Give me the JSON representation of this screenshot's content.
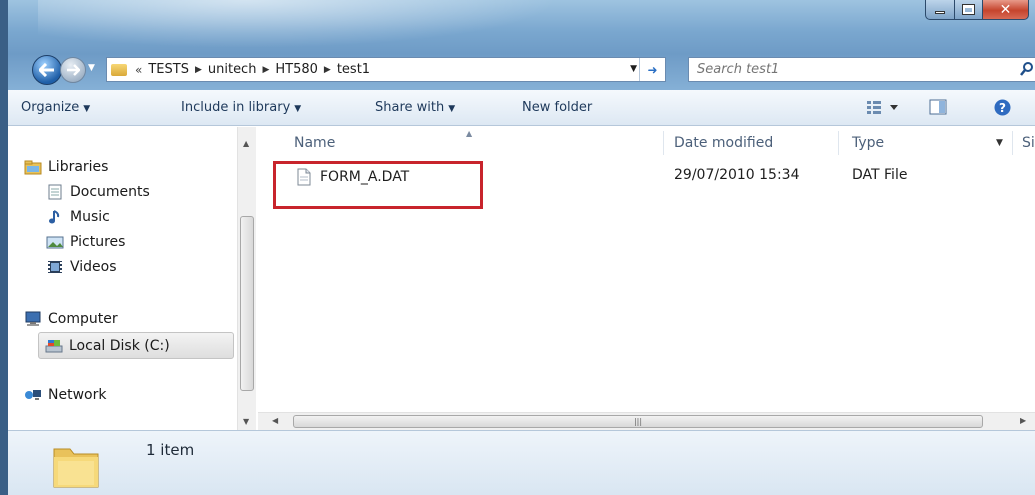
{
  "address": {
    "breadcrumb": [
      "TESTS",
      "unitech",
      "HT580",
      "test1"
    ],
    "overflow": "«"
  },
  "search": {
    "placeholder": "Search test1"
  },
  "toolbar": {
    "organize": "Organize",
    "include_in_library": "Include in library",
    "share_with": "Share with",
    "new_folder": "New folder"
  },
  "nav": {
    "libraries": "Libraries",
    "documents": "Documents",
    "music": "Music",
    "pictures": "Pictures",
    "videos": "Videos",
    "computer": "Computer",
    "local_disk": "Local Disk (C:)",
    "network": "Network"
  },
  "columns": {
    "name": "Name",
    "date_modified": "Date modified",
    "type": "Type",
    "size": "Siz"
  },
  "files": [
    {
      "name": "FORM_A.DAT",
      "date_modified": "29/07/2010 15:34",
      "type": "DAT File"
    }
  ],
  "details": {
    "item_count": "1 item"
  },
  "colors": {
    "accent": "#2a6fc4",
    "highlight_border": "#c8242c",
    "toolbar_text": "#1e395b"
  },
  "icons": [
    "back-arrow-icon",
    "forward-arrow-icon",
    "folder-icon",
    "refresh-icon",
    "search-icon",
    "views-icon",
    "preview-pane-icon",
    "help-icon",
    "libraries-icon",
    "documents-icon",
    "music-icon",
    "pictures-icon",
    "videos-icon",
    "computer-icon",
    "local-disk-icon",
    "network-icon",
    "file-icon"
  ]
}
